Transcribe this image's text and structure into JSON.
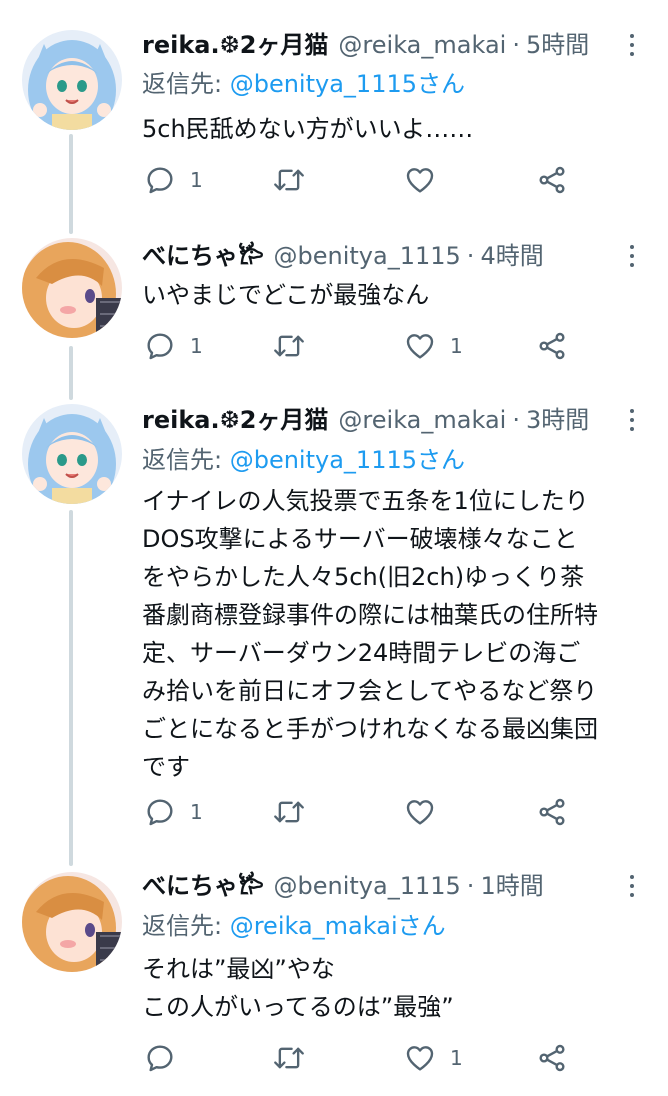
{
  "icons": {
    "reply": "reply-icon",
    "retweet": "retweet-icon",
    "like": "heart-icon",
    "share": "share-icon",
    "more": "more-vertical-icon"
  },
  "colors": {
    "link": "#1d9bf0",
    "secondary_text": "#536471",
    "thread_line": "#cfd9de"
  },
  "tweets": [
    {
      "name": "reika.❆2ヶ月猫",
      "handle": "@reika_makai",
      "dot": "·",
      "time": "5時間",
      "reply_prefix": "返信先: ",
      "reply_mention": "@benitya_1115さん",
      "lines": [
        "5ch民舐めない方がいいよ……"
      ],
      "reply_count": "1",
      "retweet_count": "",
      "like_count": ""
    },
    {
      "name": "べにちゃ𐂂",
      "handle": "@benitya_1115",
      "dot": "·",
      "time": "4時間",
      "lines": [
        "いやまじでどこが最強なん"
      ],
      "reply_count": "1",
      "retweet_count": "",
      "like_count": "1"
    },
    {
      "name": "reika.❆2ヶ月猫",
      "handle": "@reika_makai",
      "dot": "·",
      "time": "3時間",
      "reply_prefix": "返信先: ",
      "reply_mention": "@benitya_1115さん",
      "lines": [
        "イナイレの人気投票で五条を1位にしたり",
        "DOS攻撃によるサーバー破壊様々なこと",
        "をやらかした人々5ch(旧2ch)ゆっくり茶",
        "番劇商標登録事件の際には柚葉氏の住所特",
        "定、サーバーダウン24時間テレビの海ご",
        "み拾いを前日にオフ会としてやるなど祭り",
        "ごとになると手がつけれなくなる最凶集団",
        "です"
      ],
      "reply_count": "1",
      "retweet_count": "",
      "like_count": ""
    },
    {
      "name": "べにちゃ𐂂",
      "handle": "@benitya_1115",
      "dot": "·",
      "time": "1時間",
      "reply_prefix": "返信先: ",
      "reply_mention": "@reika_makaiさん",
      "lines": [
        "それは”最凶”やな",
        "この人がいってるのは”最強”"
      ],
      "reply_count": "",
      "retweet_count": "",
      "like_count": "1"
    }
  ]
}
